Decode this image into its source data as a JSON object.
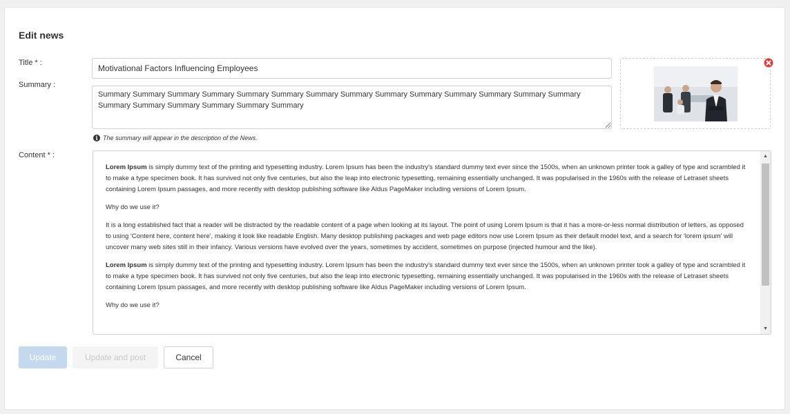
{
  "page": {
    "title": "Edit news"
  },
  "form": {
    "title_label": "Title * :",
    "title_value": "Motivational Factors Influencing Employees",
    "summary_label": "Summary :",
    "summary_value": "Summary Summary Summary Summary Summary Summary Summary Summary Summary Summary Summary Summary Summary Summary Summary Summary Summary Summary Summary Summary",
    "summary_hint": "The summary will appear in the description of the News.",
    "content_label": "Content * :"
  },
  "content": {
    "p1_bold": "Lorem Ipsum",
    "p1_rest": " is simply dummy text of the printing and typesetting industry. Lorem Ipsum has been the industry's standard dummy text ever since the 1500s, when an unknown printer took a galley of type and scrambled it to make a type specimen book. It has survived not only five centuries, but also the leap into electronic typesetting, remaining essentially unchanged. It was popularised in the 1960s with the release of Letraset sheets containing Lorem Ipsum passages, and more recently with desktop publishing software like Aldus PageMaker including versions of Lorem Ipsum.",
    "p2": "Why do we use it?",
    "p3": "It is a long established fact that a reader will be distracted by the readable content of a page when looking at its layout. The point of using Lorem Ipsum is that it has a more-or-less normal distribution of letters, as opposed to using 'Content here, content here', making it look like readable English. Many desktop publishing packages and web page editors now use Lorem Ipsum as their default model text, and a search for 'lorem ipsum' will uncover many web sites still in their infancy. Various versions have evolved over the years, sometimes by accident, sometimes on purpose (injected humour and the like).",
    "p4_bold": "Lorem Ipsum",
    "p4_rest": " is simply dummy text of the printing and typesetting industry. Lorem Ipsum has been the industry's standard dummy text ever since the 1500s, when an unknown printer took a galley of type and scrambled it to make a type specimen book. It has survived not only five centuries, but also the leap into electronic typesetting, remaining essentially unchanged. It was popularised in the 1960s with the release of Letraset sheets containing Lorem Ipsum passages, and more recently with desktop publishing software like Aldus PageMaker including versions of Lorem Ipsum.",
    "p5": "Why do we use it?"
  },
  "buttons": {
    "update": "Update",
    "update_and_post": "Update and post",
    "cancel": "Cancel"
  },
  "icons": {
    "info": "info-circle-icon",
    "remove": "remove-image-icon"
  },
  "colors": {
    "remove_icon": "#e53935",
    "update_disabled_bg": "#c5d9ee"
  }
}
